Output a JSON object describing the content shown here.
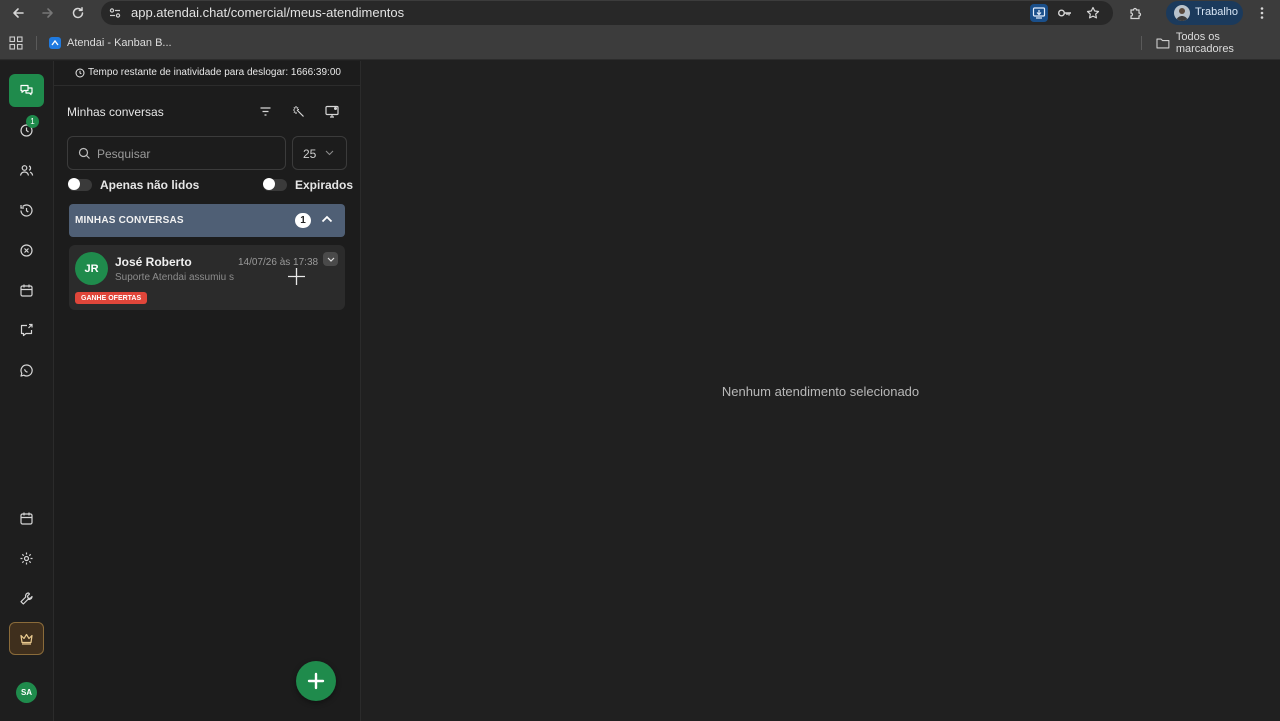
{
  "browser": {
    "url": "app.atendai.chat/comercial/meus-atendimentos",
    "profile_name": "Trabalho",
    "bookmarks": [
      {
        "label": "Atendai - Kanban B...",
        "icon": "atendai-favicon"
      }
    ],
    "all_bookmarks_label": "Todos os marcadores"
  },
  "rail": {
    "items": [
      {
        "name": "conversations",
        "icon": "chat-bubbles-icon",
        "active": true
      },
      {
        "name": "pending",
        "icon": "clock-icon",
        "badge": "1"
      },
      {
        "name": "contacts",
        "icon": "users-icon"
      },
      {
        "name": "schedules",
        "icon": "clock-history-icon"
      },
      {
        "name": "closed",
        "icon": "x-circle-icon"
      },
      {
        "name": "calendar",
        "icon": "calendar-icon"
      },
      {
        "name": "campaigns",
        "icon": "message-share-icon"
      },
      {
        "name": "whatsapp",
        "icon": "whatsapp-icon"
      },
      {
        "name": "calendar-2",
        "icon": "calendar-icon"
      },
      {
        "name": "settings",
        "icon": "gear-icon"
      },
      {
        "name": "tools",
        "icon": "wrench-icon"
      },
      {
        "name": "premium",
        "icon": "crown-icon"
      }
    ],
    "user_initials": "SA"
  },
  "panel": {
    "inactivity_text": "Tempo restante de inatividade para deslogar: 1666:39:00",
    "title": "Minhas conversas",
    "search_placeholder": "Pesquisar",
    "page_size": "25",
    "toggle_unread": "Apenas não lidos",
    "toggle_expired": "Expirados",
    "group": {
      "title": "MINHAS CONVERSAS",
      "count": "1"
    },
    "tickets": [
      {
        "initials": "JR",
        "name": "José Roberto",
        "date": "14/07/26 às 17:38",
        "preview": "Suporte Atendai assumiu s",
        "tag": "GANHE OFERTAS"
      }
    ]
  },
  "main": {
    "empty_message": "Nenhum atendimento selecionado"
  },
  "colors": {
    "accent": "#1f8b4c",
    "group_header": "#4f5f75",
    "tag": "#e0463a"
  }
}
